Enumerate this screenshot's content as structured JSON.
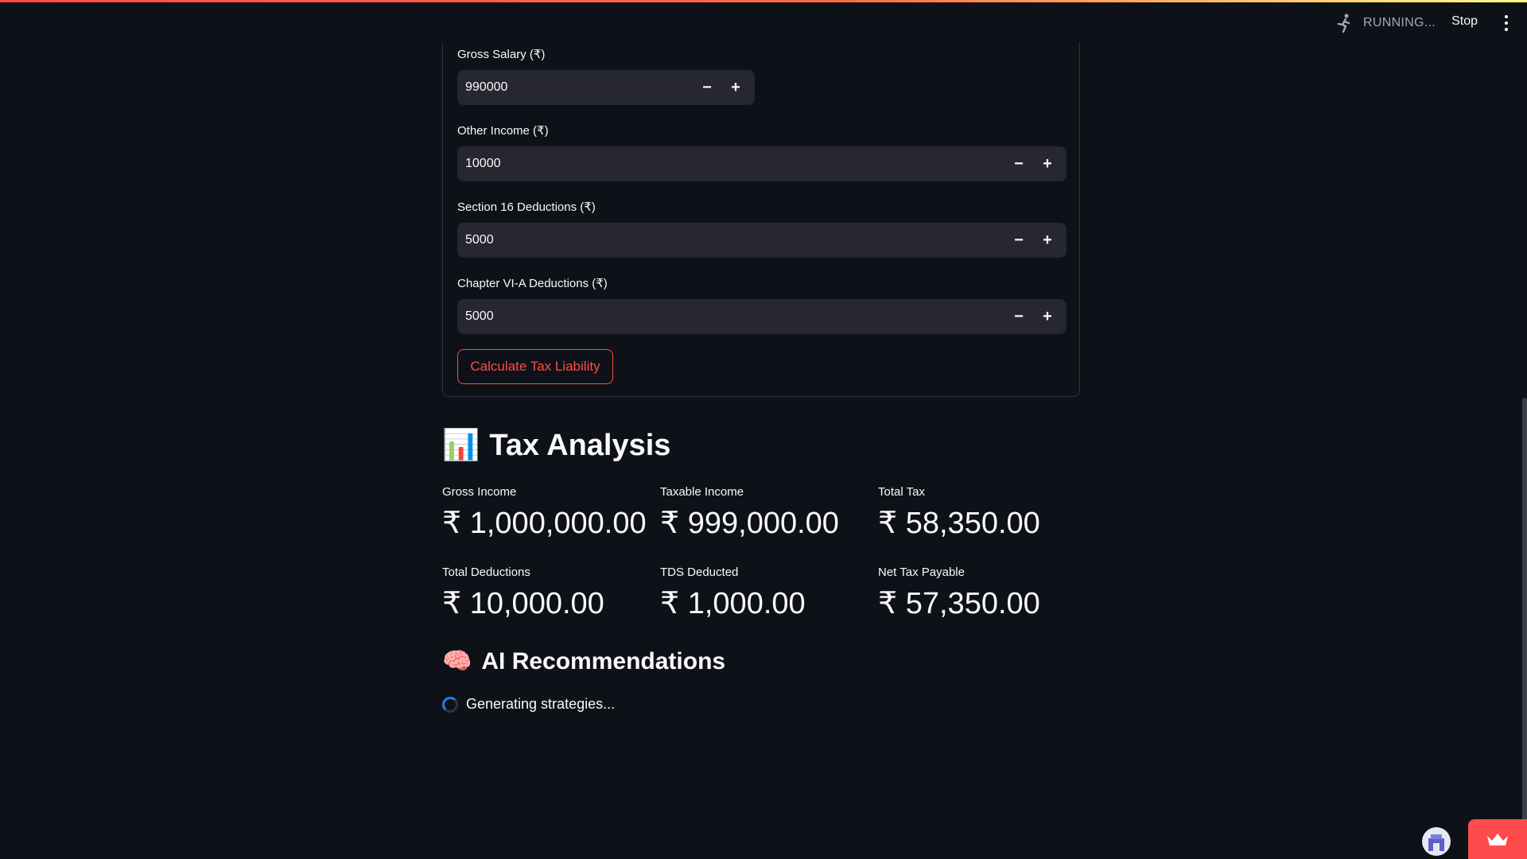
{
  "header": {
    "status_text": "RUNNING...",
    "stop_label": "Stop",
    "status_icon": "running-figure-icon",
    "menu_icon": "vertical-ellipsis-icon"
  },
  "form": {
    "fields": [
      {
        "label": "Gross Salary (₹)",
        "value": "990000"
      },
      {
        "label": "Other Income (₹)",
        "value": "10000"
      },
      {
        "label": "Section 16 Deductions (₹)",
        "value": "5000"
      },
      {
        "label": "Chapter VI-A Deductions (₹)",
        "value": "5000"
      }
    ],
    "minus_glyph": "−",
    "plus_glyph": "+",
    "submit_label": "Calculate Tax Liability"
  },
  "analysis": {
    "emoji": "📊",
    "title": "Tax Analysis",
    "metrics": [
      {
        "label": "Gross Income",
        "value": "₹ 1,000,000.00"
      },
      {
        "label": "Taxable Income",
        "value": "₹ 999,000.00"
      },
      {
        "label": "Total Tax",
        "value": "₹ 58,350.00"
      },
      {
        "label": "Total Deductions",
        "value": "₹ 10,000.00"
      },
      {
        "label": "TDS Deducted",
        "value": "₹ 1,000.00"
      },
      {
        "label": "Net Tax Payable",
        "value": "₹ 57,350.00"
      }
    ]
  },
  "recommendations": {
    "emoji": "🧠",
    "title": "AI Recommendations",
    "loading_text": "Generating strategies..."
  },
  "colors": {
    "background": "#0e1117",
    "input_bg": "#262730",
    "accent": "#ff4b4b",
    "spinner": "#1c83e1"
  }
}
